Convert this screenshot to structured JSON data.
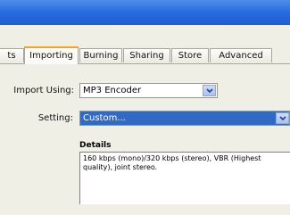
{
  "tabs": [
    {
      "label": "ts"
    },
    {
      "label": "Importing"
    },
    {
      "label": "Burning"
    },
    {
      "label": "Sharing"
    },
    {
      "label": "Store"
    },
    {
      "label": "Advanced"
    }
  ],
  "import_using": {
    "label": "Import Using:",
    "value": "MP3 Encoder"
  },
  "setting": {
    "label": "Setting:",
    "value": "Custom..."
  },
  "details": {
    "title": "Details",
    "text": "160 kbps (mono)/320 kbps (stereo), VBR (Highest quality), joint stereo."
  },
  "colors": {
    "selection": "#316ac5",
    "active_tab_accent": "#f6a22a",
    "titlebar": "#2a6fe0"
  }
}
